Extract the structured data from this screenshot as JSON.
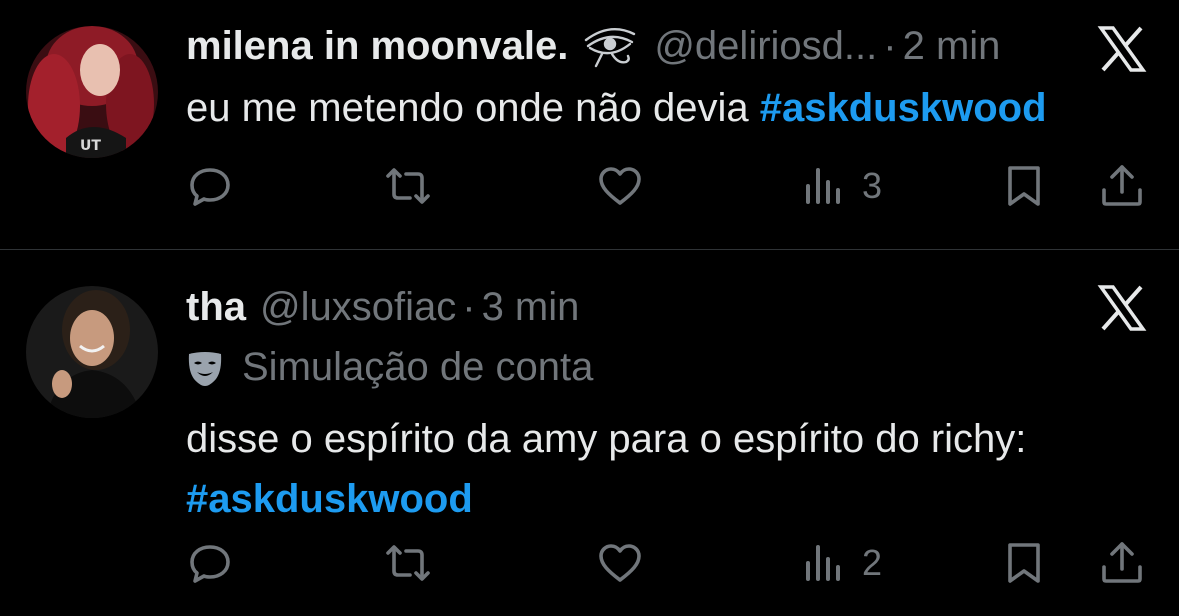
{
  "posts": [
    {
      "display_name": "milena in moonvale.",
      "handle": "@deliriosd...",
      "dot": "·",
      "time": "2 min",
      "text": "eu me metendo onde não devia",
      "hashtag": "#askduskwood",
      "views": "3",
      "badge_icon": "eye-of-horus-icon",
      "avatar_shirt_text": "UT"
    },
    {
      "display_name": "tha",
      "handle": "@luxsofiac",
      "dot": "·",
      "time": "3 min",
      "label": "Simulação de conta",
      "label_icon": "mask-icon",
      "text": "disse o espírito da amy para o espírito do richy:",
      "hashtag": "#askduskwood",
      "views": "2"
    }
  ],
  "colors": {
    "background": "#000000",
    "text": "#e7e9ea",
    "secondary": "#71767b",
    "hashtag": "#1d9bf0",
    "divider": "#2f3336"
  }
}
